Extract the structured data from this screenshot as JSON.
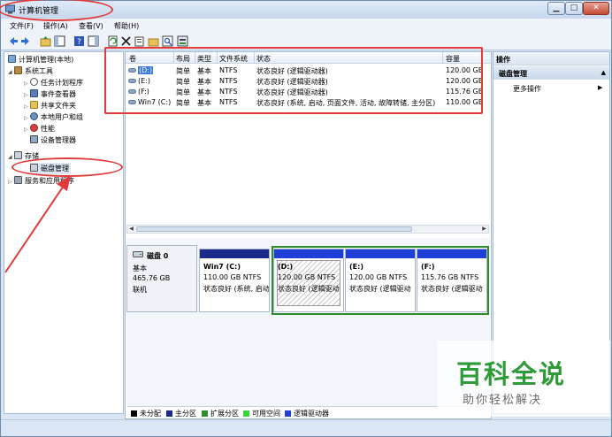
{
  "window": {
    "title": "计算机管理"
  },
  "menu": [
    "文件(F)",
    "操作(A)",
    "查看(V)",
    "帮助(H)"
  ],
  "tree": {
    "root": "计算机管理(本地)",
    "system_tools": "系统工具",
    "task_scheduler": "任务计划程序",
    "event_viewer": "事件查看器",
    "shared_folders": "共享文件夹",
    "local_users": "本地用户和组",
    "performance": "性能",
    "device_manager": "设备管理器",
    "storage": "存储",
    "disk_management": "磁盘管理",
    "services_apps": "服务和应用程序"
  },
  "volumes": {
    "columns": [
      "卷",
      "布局",
      "类型",
      "文件系统",
      "状态",
      "容量"
    ],
    "rows": [
      {
        "vol": "(D:)",
        "layout": "简单",
        "type": "基本",
        "fs": "NTFS",
        "status": "状态良好 (逻辑驱动器)",
        "capacity": "120.00 GB"
      },
      {
        "vol": "(E:)",
        "layout": "简单",
        "type": "基本",
        "fs": "NTFS",
        "status": "状态良好 (逻辑驱动器)",
        "capacity": "120.00 GB"
      },
      {
        "vol": "(F:)",
        "layout": "简单",
        "type": "基本",
        "fs": "NTFS",
        "status": "状态良好 (逻辑驱动器)",
        "capacity": "115.76 GB"
      },
      {
        "vol": "Win7 (C:)",
        "layout": "简单",
        "type": "基本",
        "fs": "NTFS",
        "status": "状态良好 (系统, 启动, 页面文件, 活动, 故障转储, 主分区)",
        "capacity": "110.00 GB"
      }
    ]
  },
  "disk": {
    "name": "磁盘 0",
    "type": "基本",
    "size": "465.76 GB",
    "state": "联机",
    "partitions": [
      {
        "name": "Win7  (C:)",
        "size": "110.00 GB NTFS",
        "status": "状态良好 (系统, 启动"
      },
      {
        "name": "(D:)",
        "size": "120.00 GB NTFS",
        "status": "状态良好 (逻辑驱动"
      },
      {
        "name": "(E:)",
        "size": "120.00 GB NTFS",
        "status": "状态良好 (逻辑驱动"
      },
      {
        "name": "(F:)",
        "size": "115.76 GB NTFS",
        "status": "状态良好 (逻辑驱动"
      }
    ]
  },
  "legend": [
    {
      "label": "未分配",
      "color": "#000000"
    },
    {
      "label": "主分区",
      "color": "#1a2a8c"
    },
    {
      "label": "扩展分区",
      "color": "#2e8b2e"
    },
    {
      "label": "可用空间",
      "color": "#3bd33b"
    },
    {
      "label": "逻辑驱动器",
      "color": "#1d3fd6"
    }
  ],
  "actions": {
    "header": "操作",
    "section": "磁盘管理",
    "more": "更多操作"
  },
  "watermark": {
    "title": "百科全说",
    "subtitle": "助你轻松解决"
  },
  "colors": {
    "accent_red": "#e03a3a",
    "primary_partition": "#1a2a8c",
    "logical_drive": "#1d3fd6",
    "extended_partition": "#2e8b2e"
  }
}
